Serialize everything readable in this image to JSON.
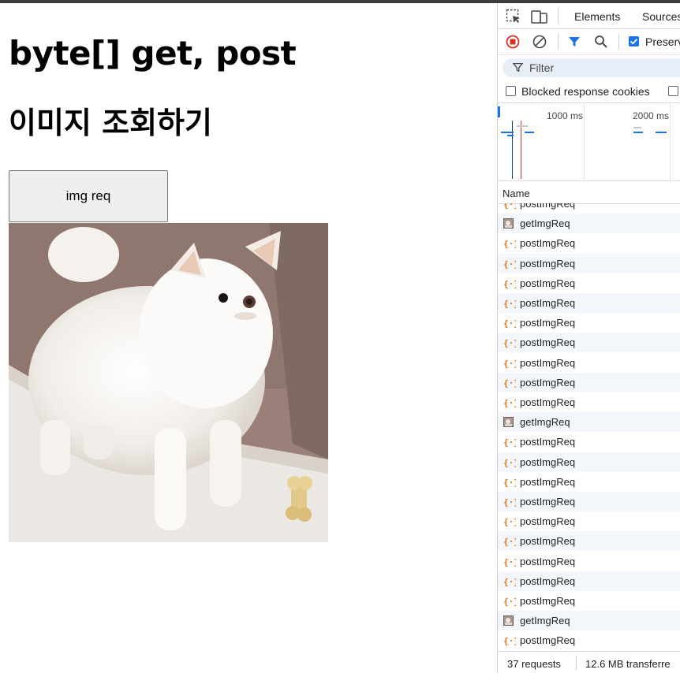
{
  "page": {
    "heading1": "byte[] get, post",
    "heading2": "이미지 조회하기",
    "button_label": "img req"
  },
  "devtools": {
    "tabs": [
      "Elements",
      "Sources"
    ],
    "filter_placeholder": "Filter",
    "preserve_log_label": "Preserv",
    "blocked_cookies_label": "Blocked response cookies",
    "timeline_ticks": [
      "1000 ms",
      "2000 ms"
    ],
    "name_column": "Name",
    "requests": [
      {
        "name": "postImgReq",
        "type": "fetch"
      },
      {
        "name": "getImgReq",
        "type": "image"
      },
      {
        "name": "postImgReq",
        "type": "fetch"
      },
      {
        "name": "postImgReq",
        "type": "fetch"
      },
      {
        "name": "postImgReq",
        "type": "fetch"
      },
      {
        "name": "postImgReq",
        "type": "fetch"
      },
      {
        "name": "postImgReq",
        "type": "fetch"
      },
      {
        "name": "postImgReq",
        "type": "fetch"
      },
      {
        "name": "postImgReq",
        "type": "fetch"
      },
      {
        "name": "postImgReq",
        "type": "fetch"
      },
      {
        "name": "postImgReq",
        "type": "fetch"
      },
      {
        "name": "getImgReq",
        "type": "image"
      },
      {
        "name": "postImgReq",
        "type": "fetch"
      },
      {
        "name": "postImgReq",
        "type": "fetch"
      },
      {
        "name": "postImgReq",
        "type": "fetch"
      },
      {
        "name": "postImgReq",
        "type": "fetch"
      },
      {
        "name": "postImgReq",
        "type": "fetch"
      },
      {
        "name": "postImgReq",
        "type": "fetch"
      },
      {
        "name": "postImgReq",
        "type": "fetch"
      },
      {
        "name": "postImgReq",
        "type": "fetch"
      },
      {
        "name": "postImgReq",
        "type": "fetch"
      },
      {
        "name": "getImgReq",
        "type": "image"
      },
      {
        "name": "postImgReq",
        "type": "fetch"
      }
    ],
    "status_requests": "37 requests",
    "status_transferred": "12.6 MB transferre"
  },
  "colors": {
    "fetch_icon": "#e8710a",
    "record_red": "#d93025",
    "filter_blue": "#1a73e8"
  }
}
